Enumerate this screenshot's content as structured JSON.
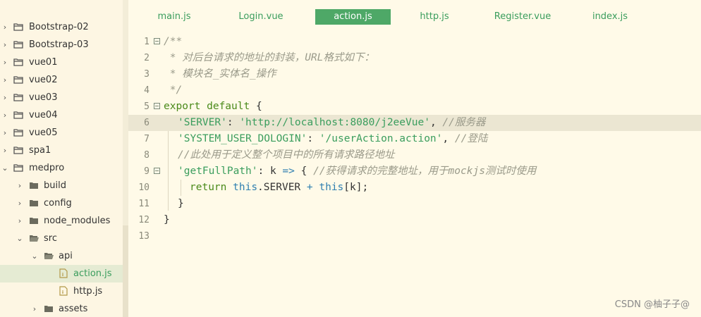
{
  "sidebar": {
    "items": [
      {
        "label": "Bootstrap-02",
        "chev": "›",
        "icon": "folder-icon"
      },
      {
        "label": "Bootstrap-03",
        "chev": "›",
        "icon": "folder-icon"
      },
      {
        "label": "vue01",
        "chev": "›",
        "icon": "folder-icon"
      },
      {
        "label": "vue02",
        "chev": "›",
        "icon": "folder-icon"
      },
      {
        "label": "vue03",
        "chev": "›",
        "icon": "folder-icon"
      },
      {
        "label": "vue04",
        "chev": "›",
        "icon": "folder-icon"
      },
      {
        "label": "vue05",
        "chev": "›",
        "icon": "folder-icon"
      },
      {
        "label": "spa1",
        "chev": "›",
        "icon": "folder-icon"
      },
      {
        "label": "medpro",
        "chev": "⌄",
        "icon": "folder-icon"
      },
      {
        "label": "build",
        "chev": "›",
        "icon": "folder-icon"
      },
      {
        "label": "config",
        "chev": "›",
        "icon": "folder-icon"
      },
      {
        "label": "node_modules",
        "chev": "›",
        "icon": "folder-icon"
      },
      {
        "label": "src",
        "chev": "⌄",
        "icon": "folder-open-icon"
      },
      {
        "label": "api",
        "chev": "⌄",
        "icon": "folder-open-icon"
      },
      {
        "label": "action.js",
        "chev": "",
        "icon": "file-js-icon"
      },
      {
        "label": "http.js",
        "chev": "",
        "icon": "file-js-icon"
      },
      {
        "label": "assets",
        "chev": "›",
        "icon": "folder-icon"
      }
    ]
  },
  "tabs": [
    "main.js",
    "Login.vue",
    "action.js",
    "http.js",
    "Register.vue",
    "index.js"
  ],
  "active_tab": "action.js",
  "line_numbers": [
    "1",
    "2",
    "3",
    "4",
    "5",
    "6",
    "7",
    "8",
    "9",
    "10",
    "11",
    "12",
    "13"
  ],
  "code": {
    "l1": "/**",
    "l2": " * 对后台请求的地址的封装，URL格式如下：",
    "l3": " * 模块名_实体名_操作",
    "l4": " */",
    "l5_kw": "export default",
    "l5_rest": " {",
    "l6_key": "'SERVER'",
    "l6_colon": ": ",
    "l6_val": "'http://localhost:8080/j2eeVue'",
    "l6_comma": ", ",
    "l6_cmt": "//服务器",
    "l7_key": "'SYSTEM_USER_DOLOGIN'",
    "l7_colon": ": ",
    "l7_val": "'/userAction.action'",
    "l7_comma": ", ",
    "l7_cmt": "//登陆",
    "l8_cmt": "//此处用于定义整个项目中的所有请求路径地址",
    "l9_key": "'getFullPath'",
    "l9_mid": ": k ",
    "l9_arrow": "=>",
    "l9_brace": " { ",
    "l9_cmt": "//获得请求的完整地址，用于mockjs测试时使用",
    "l10_kw": "return",
    "l10_this1": "this",
    "l10_mid": ".SERVER ",
    "l10_plus": "+",
    "l10_this2": "this",
    "l10_end": "[k];",
    "l11": "}",
    "l12": "}"
  },
  "watermark": "CSDN @柚子子@",
  "colors": {
    "accent": "#4ea867",
    "string": "#3a9d5d",
    "keyword": "#4a8a1a",
    "this": "#2f7fb0",
    "comment": "#9a9a8a"
  }
}
